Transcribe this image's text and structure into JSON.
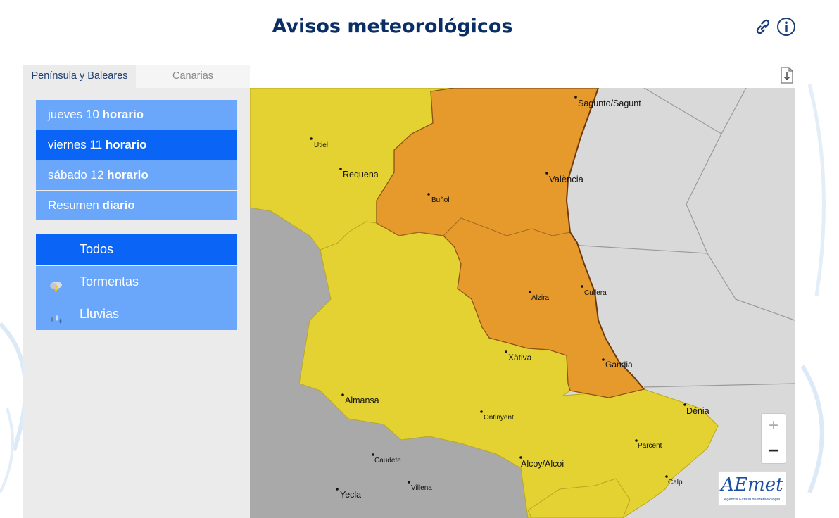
{
  "page": {
    "title": "Avisos meteorológicos"
  },
  "header_icons": {
    "link": "link-icon",
    "info": "info-icon"
  },
  "tabs": [
    {
      "label": "Península y Baleares",
      "active": true
    },
    {
      "label": "Canarias",
      "active": false
    }
  ],
  "days": [
    {
      "day": "jueves 10",
      "mode": "horario",
      "selected": false
    },
    {
      "day": "viernes 11",
      "mode": "horario",
      "selected": true
    },
    {
      "day": "sábado 12",
      "mode": "horario",
      "selected": false
    },
    {
      "day": "Resumen",
      "mode": "diario",
      "selected": false
    }
  ],
  "warning_types": [
    {
      "label": "Todos",
      "icon": "",
      "selected": true
    },
    {
      "label": "Tormentas",
      "icon": "storm-icon",
      "selected": false
    },
    {
      "label": "Lluvias",
      "icon": "rain-icon",
      "selected": false
    }
  ],
  "map": {
    "cities": [
      "Sagunto/Sagunt",
      "Utiel",
      "Requena",
      "València",
      "Buñol",
      "Alzira",
      "Cullera",
      "Xàtiva",
      "Gandia",
      "Almansa",
      "Ontinyent",
      "Dénia",
      "Parcent",
      "Caudete",
      "Alcoy/Alcoi",
      "Calp",
      "Villena",
      "Yecla"
    ],
    "zoom_in": "+",
    "zoom_out": "−",
    "colors": {
      "yellow": "#e3d232",
      "orange": "#e69a2c",
      "land": "#a9a9a9",
      "sea": "#d9d9d9"
    }
  },
  "logo": {
    "name": "AEmet",
    "subtitle": "Agencia Estatal de Meteorología"
  },
  "colors": {
    "title": "#0a2f66",
    "button": "#6aa7fb",
    "button_selected": "#0a64f5"
  }
}
